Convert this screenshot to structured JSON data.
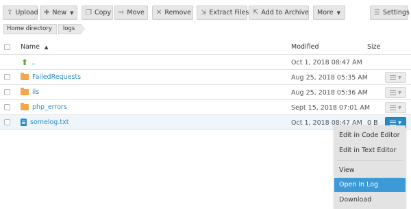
{
  "toolbar": {
    "upload": "Upload",
    "new": "New",
    "copy": "Copy",
    "move": "Move",
    "remove": "Remove",
    "extract_files": "Extract Files",
    "add_to_archive": "Add to Archive",
    "more": "More",
    "settings": "Settings"
  },
  "breadcrumb": [
    "Home directory",
    "logs"
  ],
  "table": {
    "headers": {
      "name": "Name",
      "modified": "Modified",
      "size": "Size"
    },
    "rows": [
      {
        "name": "..",
        "modified": "Oct 1, 2018 08:47 AM",
        "size": "",
        "type": "parent"
      },
      {
        "name": "FailedRequests",
        "modified": "Aug 25, 2018 05:35 AM",
        "size": "",
        "type": "folder"
      },
      {
        "name": "iis",
        "modified": "Aug 25, 2018 05:36 AM",
        "size": "",
        "type": "folder"
      },
      {
        "name": "php_errors",
        "modified": "Sept 15, 2018 07:01 AM",
        "size": "",
        "type": "folder"
      },
      {
        "name": "somelog.txt",
        "modified": "Oct 1, 2018 08:47 AM",
        "size": "0 B",
        "type": "file"
      }
    ]
  },
  "context_menu": {
    "items": [
      "Edit in Code Editor",
      "Edit in Text Editor",
      "View",
      "Open in Log Browser",
      "Download"
    ],
    "highlighted": "Open in Log Browser"
  },
  "colors": {
    "link": "#2a8ac8",
    "folder": "#f5a54a",
    "highlight": "#3d9ad6",
    "parent_arrow": "#5aa93c"
  }
}
